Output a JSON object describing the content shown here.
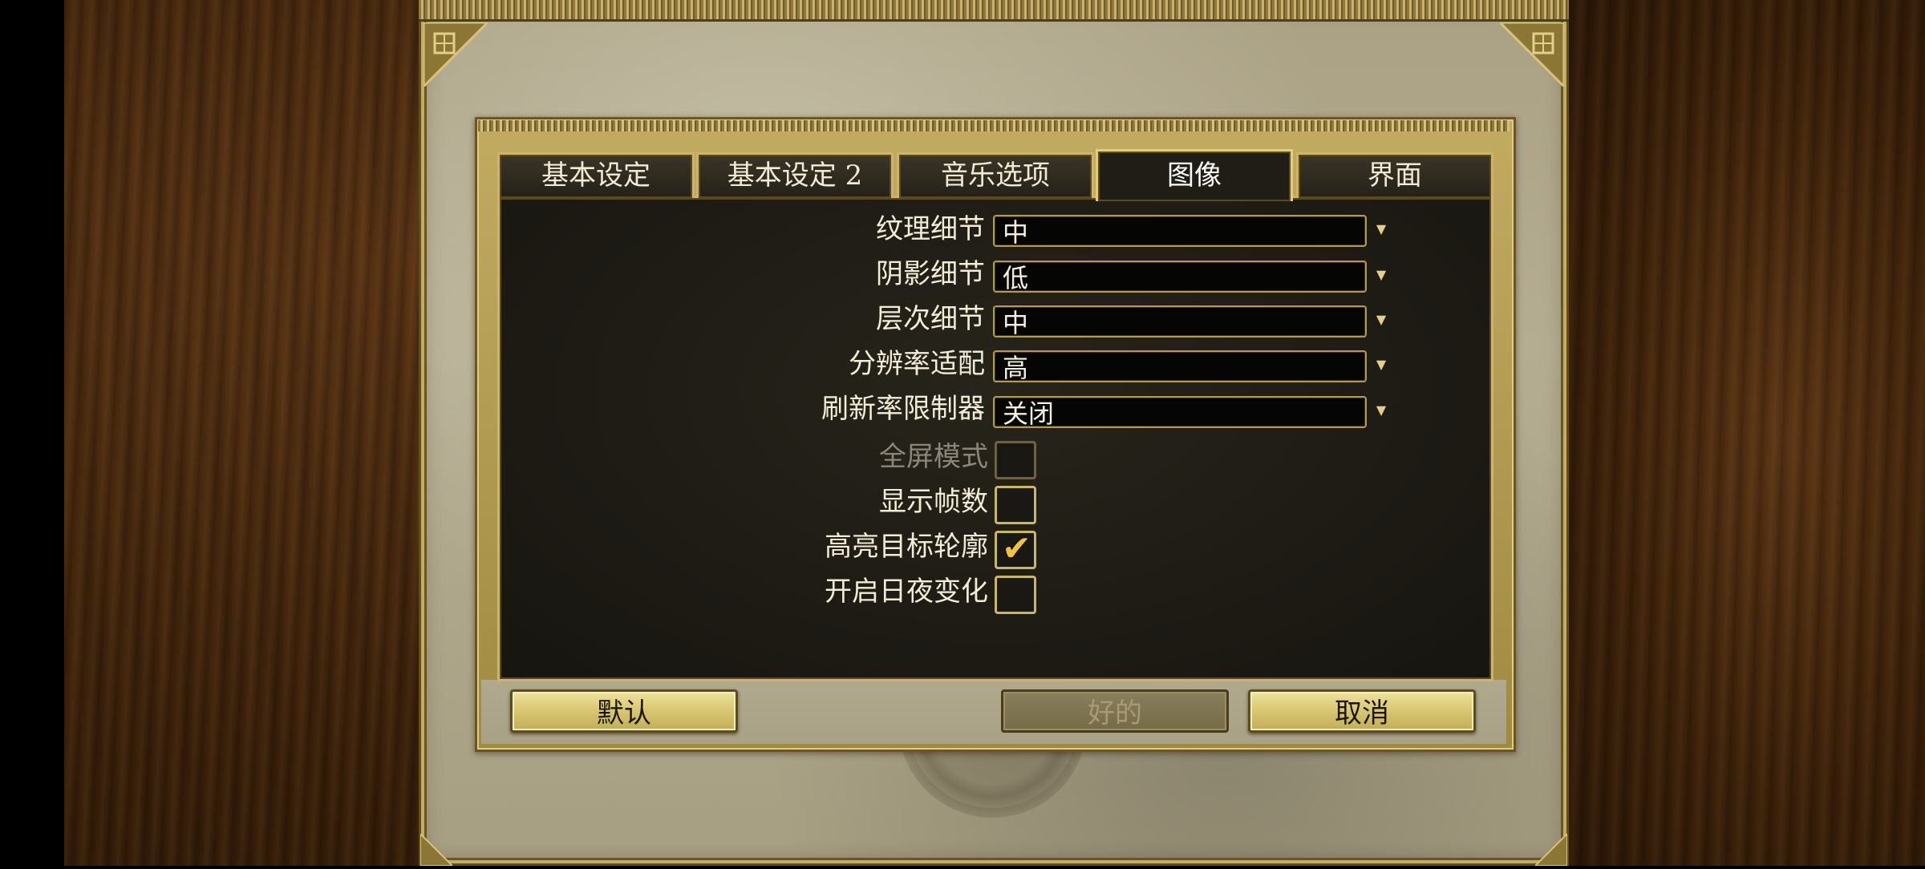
{
  "tabs": [
    {
      "label": "基本设定",
      "active": false
    },
    {
      "label": "基本设定 2",
      "active": false
    },
    {
      "label": "音乐选项",
      "active": false
    },
    {
      "label": "图像",
      "active": true
    },
    {
      "label": "界面",
      "active": false
    }
  ],
  "settings": {
    "dropdowns": [
      {
        "label": "纹理细节",
        "value": "中"
      },
      {
        "label": "阴影细节",
        "value": "低"
      },
      {
        "label": "层次细节",
        "value": "中"
      },
      {
        "label": "分辨率适配",
        "value": "高"
      },
      {
        "label": "刷新率限制器",
        "value": "关闭"
      }
    ],
    "checkboxes": [
      {
        "label": "全屏模式",
        "checked": false,
        "disabled": true
      },
      {
        "label": "显示帧数",
        "checked": false,
        "disabled": false
      },
      {
        "label": "高亮目标轮廓",
        "checked": true,
        "disabled": false
      },
      {
        "label": "开启日夜变化",
        "checked": false,
        "disabled": false
      }
    ]
  },
  "buttons": {
    "default_label": "默认",
    "ok_label": "好的",
    "ok_disabled": true,
    "cancel_label": "取消"
  },
  "icons": {
    "dropdown_arrow": "chevron-down-icon",
    "check": "checkmark-icon"
  },
  "colors": {
    "accent_gold": "#cdb46a",
    "panel_dark": "#1f1d16",
    "check_yellow": "#f0c240"
  }
}
